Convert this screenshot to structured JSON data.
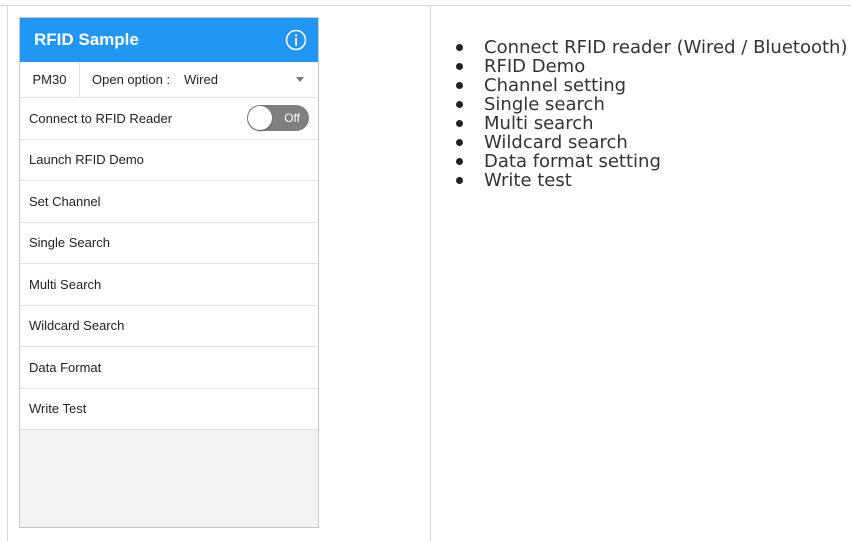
{
  "app": {
    "title": "RFID Sample",
    "accent_color": "#2196f3",
    "info_icon": "info-icon"
  },
  "options": {
    "model": "PM30",
    "open_option_label": "Open option :",
    "open_option_value": "Wired"
  },
  "menu": {
    "connect_label": "Connect to RFID Reader",
    "connect_toggle": "Off",
    "items": [
      "Launch RFID Demo",
      "Set Channel",
      "Single Search",
      "Multi Search",
      "Wildcard Search",
      "Data Format",
      "Write Test"
    ]
  },
  "features": [
    "Connect RFID reader (Wired / Bluetooth)",
    "RFID Demo",
    "Channel setting",
    "Single search",
    "Multi search",
    "Wildcard search",
    "Data format setting",
    "Write test"
  ]
}
